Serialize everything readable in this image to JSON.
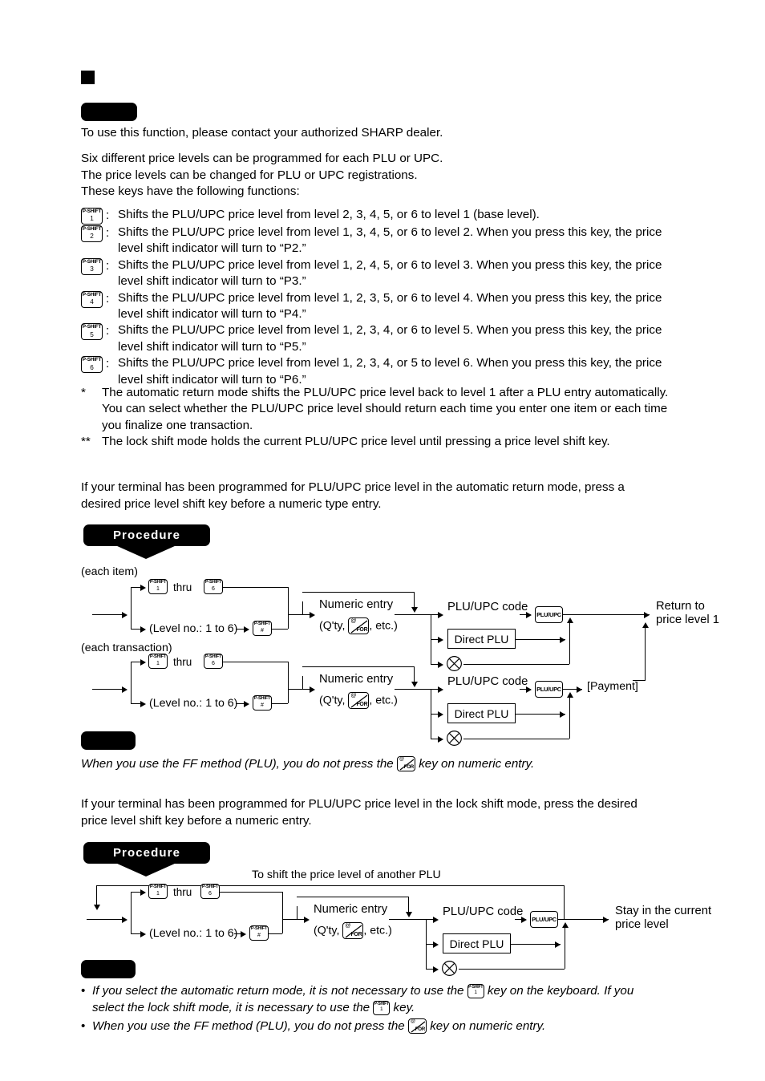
{
  "document": {
    "section_marker": "black-square-bullet",
    "redacted_label_1": "",
    "intro_line": "To use this function, please contact your authorized SHARP dealer.",
    "para_lines": [
      "Six different price levels can be programmed for each PLU or UPC.",
      "The price levels can be changed for PLU or UPC registrations.",
      "These keys have the following functions:"
    ]
  },
  "key_list": [
    {
      "key_top": "P-SHIFT",
      "key_bottom": "1",
      "colon": ":",
      "lines": [
        "Shifts the PLU/UPC price level from level 2, 3, 4, 5, or 6 to level 1 (base level)."
      ]
    },
    {
      "key_top": "P-SHIFT",
      "key_bottom": "2",
      "colon": ":",
      "lines": [
        "Shifts the PLU/UPC price level from level 1, 3, 4, 5, or 6 to level 2.  When you press this key, the price",
        "level shift indicator will turn to “P2.”"
      ]
    },
    {
      "key_top": "P-SHIFT",
      "key_bottom": "3",
      "colon": ":",
      "lines": [
        "Shifts the PLU/UPC price level from level 1, 2, 4, 5, or 6 to level 3.  When you press this key, the price",
        "level shift indicator will turn to “P3.”"
      ]
    },
    {
      "key_top": "P-SHIFT",
      "key_bottom": "4",
      "colon": ":",
      "lines": [
        "Shifts the PLU/UPC price level from level 1, 2, 3, 5, or 6 to level 4.  When you press this key, the price",
        "level shift indicator will turn to “P4.”"
      ]
    },
    {
      "key_top": "P-SHIFT",
      "key_bottom": "5",
      "colon": ":",
      "lines": [
        "Shifts the PLU/UPC price level from level 1, 2, 3, 4, or 6 to level 5.  When you press this key, the price",
        "level shift indicator will turn to “P5.”"
      ]
    },
    {
      "key_top": "P-SHIFT",
      "key_bottom": "6",
      "colon": ":",
      "lines": [
        "Shifts the PLU/UPC price level from level 1, 2, 3, 4, or 5 to level 6.  When you press this key, the price",
        "level shift indicator will turn to “P6.”"
      ]
    }
  ],
  "star_notes": [
    {
      "marker": "*",
      "lines": [
        "The automatic return mode shifts the PLU/UPC price level back to level 1 after a PLU entry automatically.",
        "You can select whether the PLU/UPC price level should return each time you enter one item or each time",
        "you finalize one transaction."
      ]
    },
    {
      "marker": "**",
      "lines": [
        "The lock shift mode holds the current PLU/UPC price level until pressing a price level shift key."
      ]
    }
  ],
  "auto_return_intro": [
    "If your terminal has been programmed for PLU/UPC price level in the automatic return mode, press a",
    "desired price level shift key before a numeric type entry."
  ],
  "procedure_banner_1": "Procedure",
  "flow_auto": {
    "caption_item": "(each item)",
    "caption_transaction": "(each transaction)",
    "key_pshift_top": "P-SHIFT",
    "key_first": "1",
    "key_last": "6",
    "thru": "thru",
    "level_no": "(Level no.: 1 to 6)",
    "key_hash": "#",
    "numeric_entry": "Numeric entry",
    "numeric_detail_pre": "(Q'ty, ",
    "numeric_detail_post": ", etc.)",
    "for_key_at": "@",
    "for_key_for": "FOR",
    "plu_upc_code": "PLU/UPC code",
    "plu_upc_key": "PLU/UPC",
    "direct_plu": "Direct PLU",
    "multiply_symbol": "circle-x",
    "result_item_line1": "Return to",
    "result_item_line2": "price level 1",
    "payment": "[Payment]"
  },
  "note_1": {
    "redacted_label": "",
    "text_pre": "When you use the FF method (PLU), you do not press the ",
    "text_post": " key on numeric entry.",
    "for_key_at": "@",
    "for_key_for": "FOR"
  },
  "lock_shift_intro": [
    "If your terminal has been programmed for PLU/UPC price level in the lock shift mode, press the desired",
    "price level shift key before a numeric entry."
  ],
  "procedure_banner_2": "Procedure",
  "flow_lock": {
    "loop_caption": "To shift the price level of another PLU",
    "key_pshift_top": "P-SHIFT",
    "key_first": "1",
    "key_last": "6",
    "thru": "thru",
    "level_no": "(Level no.: 1 to 6)",
    "key_hash": "#",
    "numeric_entry": "Numeric entry",
    "numeric_detail_pre": "(Q'ty, ",
    "numeric_detail_post": ", etc.)",
    "for_key_at": "@",
    "for_key_for": "FOR",
    "plu_upc_code": "PLU/UPC code",
    "plu_upc_key": "PLU/UPC",
    "direct_plu": "Direct PLU",
    "multiply_symbol": "circle-x",
    "result_line1": "Stay in the current",
    "result_line2": "price level"
  },
  "note_2": {
    "redacted_label": "",
    "bullets": [
      {
        "marker": "•",
        "seg1": "If you select the automatic return mode, it is not necessary to use the ",
        "seg2": " key on the keyboard.  If you",
        "seg3": "select the lock shift mode, it is necessary to use the ",
        "seg4": " key.",
        "key_top": "P-SHIFT",
        "key_bottom": "1"
      },
      {
        "marker": "•",
        "seg1": "When you use the FF method (PLU), you do not press the ",
        "seg2": " key on numeric entry.",
        "for_key_at": "@",
        "for_key_for": "FOR"
      }
    ]
  },
  "colors": {
    "ink": "#000000",
    "paper": "#ffffff"
  }
}
